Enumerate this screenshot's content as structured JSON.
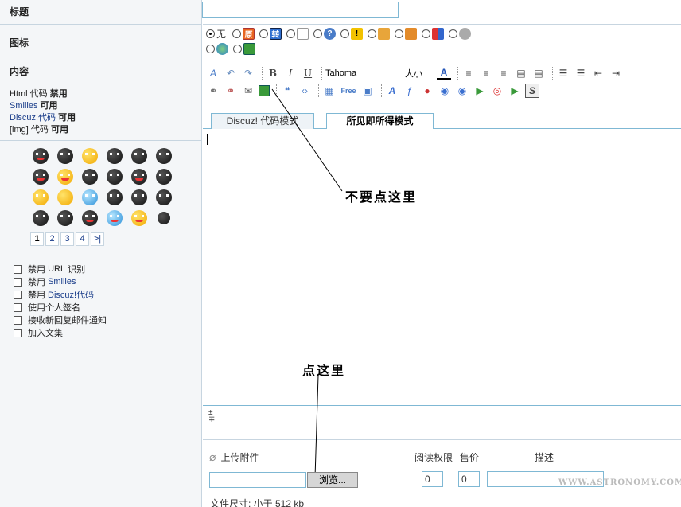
{
  "labels": {
    "title": "标题",
    "icon": "图标",
    "content": "内容"
  },
  "rules": [
    {
      "name": "Html 代码",
      "state": "禁用"
    },
    {
      "name": "Smilies",
      "state": "可用"
    },
    {
      "name": "Discuz!代码",
      "state": "可用"
    },
    {
      "name": "[img] 代码",
      "state": "可用"
    }
  ],
  "icons": {
    "none_label": "无",
    "orig_label": "原",
    "repost_label": "转"
  },
  "toolbar": {
    "bold": "B",
    "italic": "I",
    "underline": "U",
    "font_name": "Tahoma",
    "font_size": "大小",
    "text_color": "A",
    "free": "Free",
    "strike": "S"
  },
  "tabs": [
    {
      "label": "Discuz! 代码模式",
      "active": false
    },
    {
      "label": "所见即所得模式",
      "active": true
    }
  ],
  "annotations": {
    "dont_click": "不要点这里",
    "click_here": "点这里"
  },
  "smilies_pager": [
    "1",
    "2",
    "3",
    "4",
    ">|"
  ],
  "options": [
    {
      "prefix": "禁用",
      "key": "URL",
      "suffix": "识别"
    },
    {
      "prefix": "禁用",
      "key": "Smilies",
      "suffix": ""
    },
    {
      "prefix": "禁用",
      "key": "Discuz!代码",
      "suffix": ""
    },
    {
      "prefix": "使用个人签名",
      "key": "",
      "suffix": ""
    },
    {
      "prefix": "接收新回复邮件通知",
      "key": "",
      "suffix": ""
    },
    {
      "prefix": "加入文集",
      "key": "",
      "suffix": ""
    }
  ],
  "upload": {
    "label": "上传附件",
    "read_perm": "阅读权限",
    "price": "售价",
    "desc": "描述",
    "browse": "浏览...",
    "read_perm_value": "0",
    "price_value": "0",
    "file_size": "文件尺寸: 小于 512 kb"
  },
  "watermark": "WWW.ASTRONOMY.COM.CN"
}
